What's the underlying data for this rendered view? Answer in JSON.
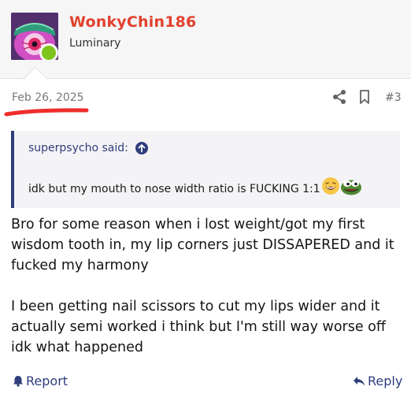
{
  "user": {
    "name": "WonkyChin186",
    "title": "Luminary"
  },
  "post": {
    "date": "Feb 26, 2025",
    "number": "#3"
  },
  "quote": {
    "author_line": "superpsycho said:",
    "text": "idk but my mouth to nose width ratio is FUCKING 1:1"
  },
  "message": {
    "paragraphs": [
      "Bro for some reason when i lost weight/got my first wisdom tooth in, my lip corners just DISSAPERED and it fucked my harmony",
      "I been getting nail scissors to cut my lips wider and it actually semi worked i think but I'm still way worse off idk what happened"
    ]
  },
  "footer": {
    "report_label": "Report",
    "reply_label": "Reply"
  },
  "colors": {
    "username": "#e2412e",
    "link": "#2f3d7c",
    "online": "#7fc41c",
    "annotation": "#ee2d2d"
  },
  "icons": {
    "share": "share-icon",
    "bookmark": "bookmark-icon",
    "quote_jump": "arrow-up-circle-icon",
    "report": "bell-icon",
    "reply": "reply-arrow-icon"
  }
}
